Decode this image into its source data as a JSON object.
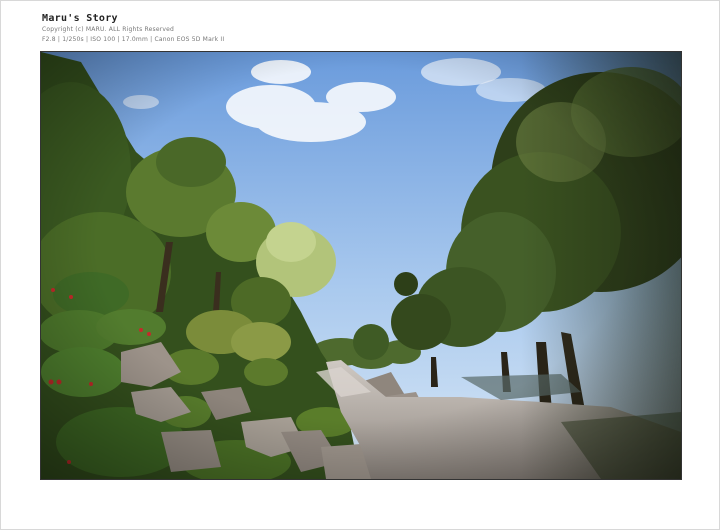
{
  "header": {
    "title": "Maru's Story",
    "copyright": "Copyright (c) MARU. ALL Rights Reserved",
    "exif": "F2.8 | 1/250s | ISO 100 | 17.0mm | Canon EOS 5D Mark II"
  },
  "photo": {
    "subject": "japanese-garden-landscape",
    "colors": {
      "sky_top": "#6f9fdf",
      "sky_bottom": "#cfe2f6",
      "foliage_dark": "#2f4a1c",
      "foliage_mid": "#5f7f2a",
      "foliage_light": "#a8c060",
      "rock": "#9a8f85",
      "path": "#b9b2ad"
    }
  }
}
